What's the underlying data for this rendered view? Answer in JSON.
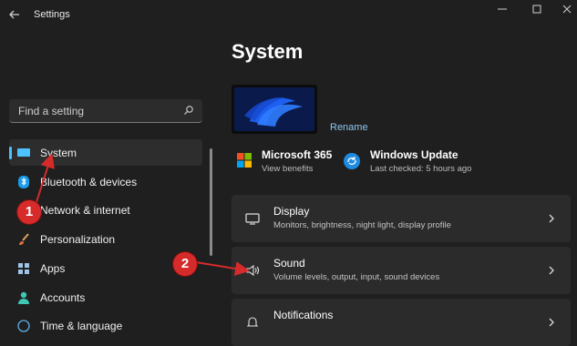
{
  "window": {
    "title": "Settings"
  },
  "search": {
    "placeholder": "Find a setting"
  },
  "sidebar": {
    "items": [
      {
        "label": "System",
        "icon": "monitor-icon",
        "active": true
      },
      {
        "label": "Bluetooth & devices",
        "icon": "bluetooth-icon"
      },
      {
        "label": "Network & internet",
        "icon": "wifi-icon"
      },
      {
        "label": "Personalization",
        "icon": "brush-icon"
      },
      {
        "label": "Apps",
        "icon": "apps-icon"
      },
      {
        "label": "Accounts",
        "icon": "person-icon"
      },
      {
        "label": "Time & language",
        "icon": "clock-icon"
      }
    ]
  },
  "main": {
    "title": "System",
    "rename_label": "Rename",
    "quick_cards": [
      {
        "title": "Microsoft 365",
        "subtitle": "View benefits",
        "icon": "microsoft-logo-icon"
      },
      {
        "title": "Windows Update",
        "subtitle": "Last checked: 5 hours ago",
        "icon": "update-icon"
      }
    ],
    "rows": [
      {
        "title": "Display",
        "subtitle": "Monitors, brightness, night light, display profile",
        "icon": "display-icon"
      },
      {
        "title": "Sound",
        "subtitle": "Volume levels, output, input, sound devices",
        "icon": "speaker-icon"
      },
      {
        "title": "Notifications",
        "subtitle": "",
        "icon": "bell-icon"
      }
    ]
  },
  "annotations": [
    {
      "label": "1"
    },
    {
      "label": "2"
    }
  ],
  "colors": {
    "accent": "#4cc2ff",
    "callout": "#d62b2b",
    "link": "#8ec7ee"
  }
}
